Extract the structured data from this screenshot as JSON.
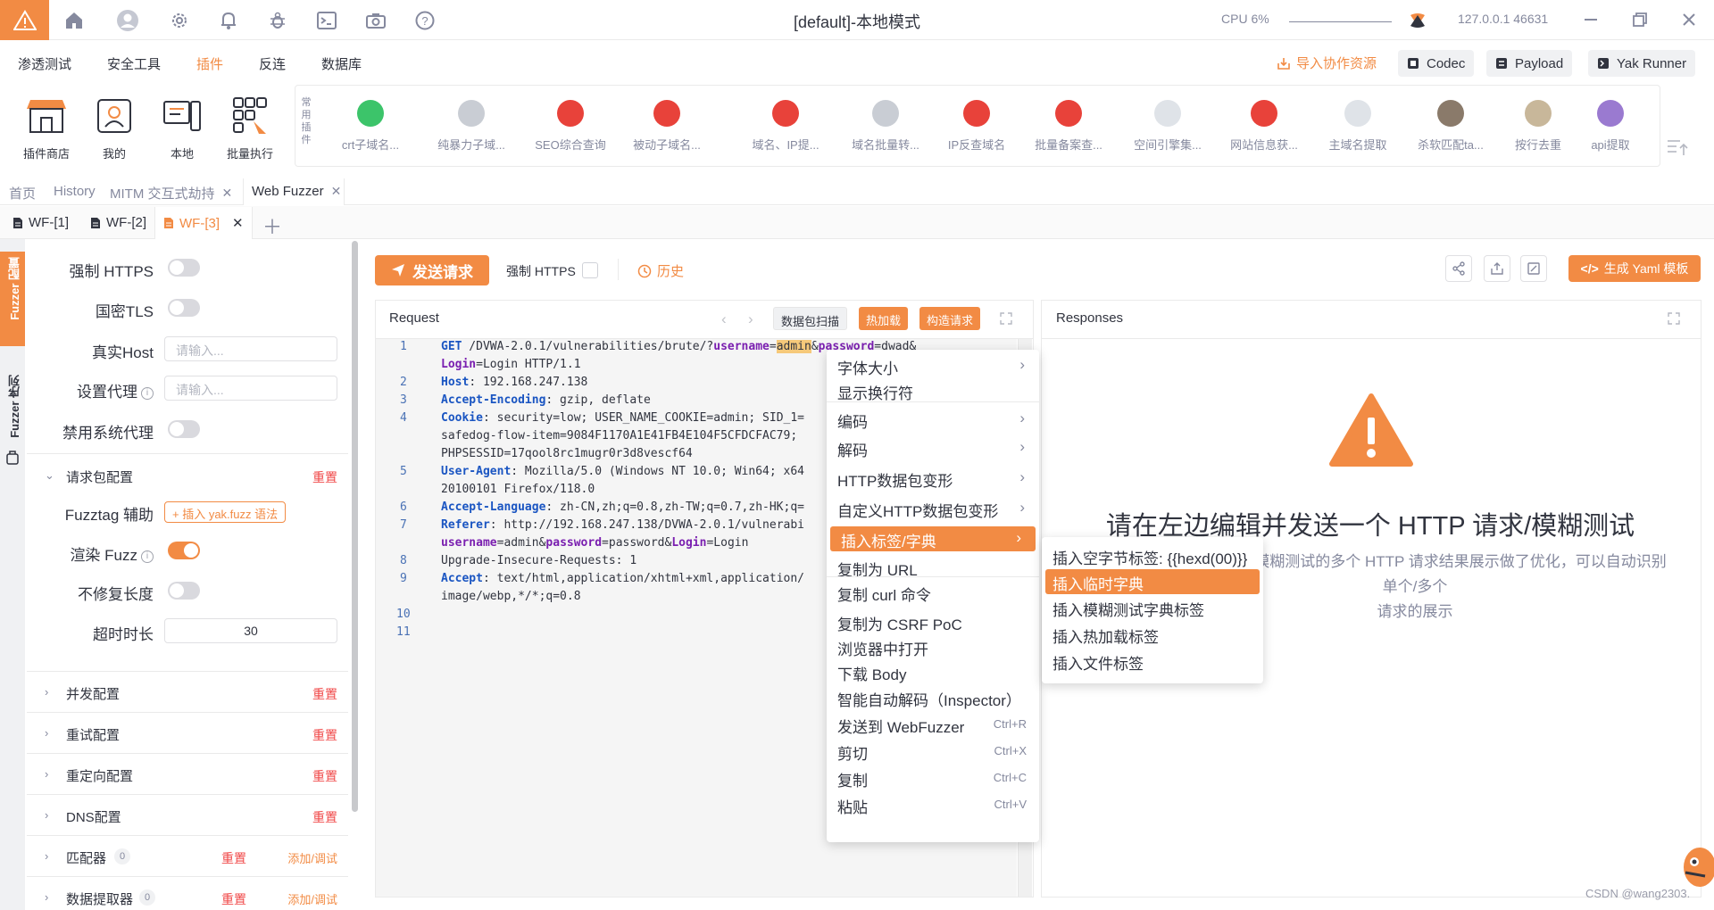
{
  "topbar": {
    "title": "[default]-本地模式",
    "cpu": "CPU 6%",
    "engine": "127.0.0.1 46631"
  },
  "menubar": {
    "items": [
      "渗透测试",
      "安全工具",
      "插件",
      "反连",
      "数据库"
    ],
    "active_index": 2,
    "import_link": "导入协作资源",
    "codec": "Codec",
    "payload": "Payload",
    "yak_runner": "Yak Runner"
  },
  "toolbar": {
    "tools": [
      "插件商店",
      "我的",
      "本地",
      "批量执行"
    ],
    "common_label": "常用插件",
    "plugins": [
      "crt子域名...",
      "纯暴力子域...",
      "SEO综合查询",
      "被动子域名...",
      "域名、IP提...",
      "域名批量转...",
      "IP反查域名",
      "批量备案查...",
      "空间引擎集...",
      "网站信息获...",
      "主域名提取",
      "杀软匹配ta...",
      "按行去重",
      "api提取"
    ]
  },
  "page_tabs": [
    "首页",
    "History",
    "MITM 交互式劫持",
    "Web Fuzzer"
  ],
  "fuzzer_tabs": [
    "WF-[1]",
    "WF-[2]",
    "WF-[3]"
  ],
  "side_tabs": [
    "Fuzzer 配置",
    "Fuzzer 序列"
  ],
  "config": {
    "force_https": "强制 HTTPS",
    "gm_tls": "国密TLS",
    "real_host": "真实Host",
    "real_host_placeholder": "请输入...",
    "proxy": "设置代理",
    "proxy_placeholder": "请输入...",
    "disable_proxy": "禁用系统代理",
    "request_config": "请求包配置",
    "reset": "重置",
    "fuzztag_helper": "Fuzztag 辅助",
    "fuzztag_btn": "+ 插入 yak.fuzz 语法",
    "render_fuzz": "渲染 Fuzz",
    "no_fix_length": "不修复长度",
    "timeout": "超时时长",
    "timeout_value": "30",
    "sections": [
      "并发配置",
      "重试配置",
      "重定向配置",
      "DNS配置"
    ],
    "matcher": "匹配器",
    "matcher_count": "0",
    "extractor": "数据提取器",
    "extractor_count": "0",
    "add_debug": "添加/调试"
  },
  "main": {
    "send": "发送请求",
    "force_https": "强制 HTTPS",
    "history": "历史",
    "yaml": "生成 Yaml 模板",
    "request_title": "Request",
    "scan_btn": "数据包扫描",
    "hotload_btn": "热加载",
    "construct_btn": "构造请求",
    "responses_title": "Responses",
    "resp_big": "请在左边编辑并发送一个 HTTP 请求/模糊测试",
    "resp_sub_1": "本栏结果针对模糊测试的多个 HTTP 请求结果展示做了优化，可以自动识别单个/多个",
    "resp_sub_2": "请求的展示"
  },
  "code_lines": {
    "l1a_method": "GET",
    "l1a_path": " /DVWA-2.0.1/vulnerabilities/brute/?",
    "l1a_u": "username",
    "l1a_eq": "=",
    "l1a_admin": "admin",
    "l1a_amp": "&",
    "l1a_p": "password",
    "l1a_rest": "=dwad&",
    "l1b_k": "Login",
    "l1b_rest": "=Login HTTP/1.1",
    "l2_k": "Host",
    "l2_v": ": 192.168.247.138",
    "l3_k": "Accept-Encoding",
    "l3_v": ": gzip, deflate",
    "l4_k": "Cookie",
    "l4_v": ": security=low; USER_NAME_COOKIE=admin; SID_1=",
    "l4b": "safedog-flow-item=9084F1170A1E41FB4E104F5CFDCFAC79;",
    "l4c": "PHPSESSID=17qool8rc1mugr0r3d8vescf64",
    "l5_k": "User-Agent",
    "l5_v": ": Mozilla/5.0 (Windows NT 10.0; Win64; x64",
    "l5b": "20100101 Firefox/118.0",
    "l6_k": "Accept-Language",
    "l6_v": ": zh-CN,zh;q=0.8,zh-TW;q=0.7,zh-HK;q=",
    "l7_k": "Referer",
    "l7_v": ": http://192.168.247.138/DVWA-2.0.1/vulnerabi",
    "l7b_u": "username",
    "l7b_1": "=admin&",
    "l7b_p": "password",
    "l7b_2": "=password&",
    "l7b_l": "Login",
    "l7b_3": "=Login",
    "l8": "Upgrade-Insecure-Requests: 1",
    "l9_k": "Accept",
    "l9_v": ": text/html,application/xhtml+xml,application/",
    "l9b": "image/webp,*/*;q=0.8",
    "line_numbers": [
      "1",
      "2",
      "3",
      "4",
      "5",
      "6",
      "7",
      "8",
      "9",
      "10",
      "11"
    ]
  },
  "context_menu": {
    "items": [
      {
        "label": "字体大小",
        "arrow": true
      },
      {
        "label": "显示换行符"
      },
      {
        "label": "编码",
        "arrow": true
      },
      {
        "label": "解码",
        "arrow": true
      },
      {
        "label": "HTTP数据包变形",
        "arrow": true
      },
      {
        "label": "自定义HTTP数据包变形",
        "arrow": true
      },
      {
        "label": "插入标签/字典",
        "arrow": true
      },
      {
        "label": "复制为 URL"
      },
      {
        "label": "复制 curl 命令"
      },
      {
        "label": "复制为 CSRF PoC"
      },
      {
        "label": "浏览器中打开"
      },
      {
        "label": "下载 Body"
      },
      {
        "label": "智能自动解码（Inspector）"
      },
      {
        "label": "发送到 WebFuzzer",
        "shortcut": "Ctrl+R"
      },
      {
        "label": "剪切",
        "shortcut": "Ctrl+X"
      },
      {
        "label": "复制",
        "shortcut": "Ctrl+C"
      },
      {
        "label": "粘贴",
        "shortcut": "Ctrl+V"
      }
    ],
    "arrow_glyph": "›",
    "submenu": [
      "插入空字节标签: {{hexd(00)}}",
      "插入临时字典",
      "插入模糊测试字典标签",
      "插入热加载标签",
      "插入文件标签"
    ]
  },
  "watermark": "CSDN @wang2303."
}
